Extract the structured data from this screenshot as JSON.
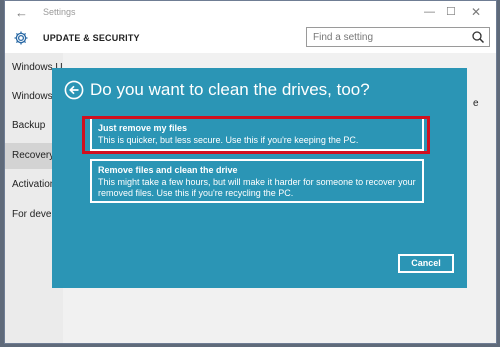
{
  "window": {
    "title": "Settings",
    "controls": {
      "minimize": "—",
      "maximize": "☐",
      "close": "✕"
    }
  },
  "header": {
    "heading": "UPDATE & SECURITY",
    "search_placeholder": "Find a setting"
  },
  "sidebar": {
    "items": [
      {
        "label": "Windows Update"
      },
      {
        "label": "Windows Defender"
      },
      {
        "label": "Backup"
      },
      {
        "label": "Recovery",
        "selected": true
      },
      {
        "label": "Activation"
      },
      {
        "label": "For developers"
      }
    ]
  },
  "content": {
    "snippet": "e"
  },
  "dialog": {
    "title": "Do you want to clean the drives, too?",
    "options": [
      {
        "title": "Just remove my files",
        "description": "This is quicker, but less secure. Use this if you're keeping the PC."
      },
      {
        "title": "Remove files and clean the drive",
        "description": "This might take a few hours, but will make it harder for someone to recover your removed files. Use this if you're recycling the PC."
      }
    ],
    "cancel_label": "Cancel",
    "highlight_color": "#d0101f",
    "background_color": "#2b95b5"
  },
  "icons": {
    "back": "back-arrow-icon",
    "gear": "gear-icon",
    "search": "search-icon",
    "dialog_back": "circle-back-arrow-icon"
  }
}
